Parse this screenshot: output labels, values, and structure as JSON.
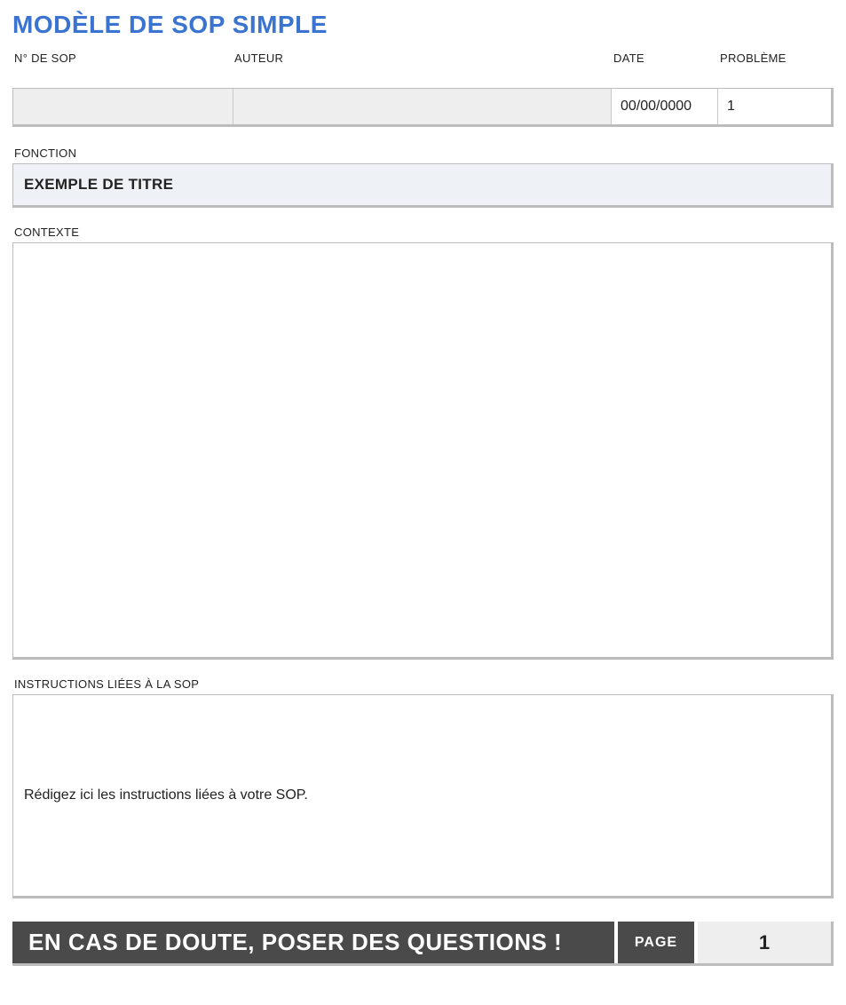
{
  "title": "MODÈLE DE SOP SIMPLE",
  "headers": {
    "sop_no": "N° DE SOP",
    "author": "AUTEUR",
    "date": "DATE",
    "problem": "PROBLÈME"
  },
  "values": {
    "sop_no": "",
    "author": "",
    "date": "00/00/0000",
    "problem": "1"
  },
  "fonction": {
    "label": "FONCTION",
    "value": "EXEMPLE DE TITRE"
  },
  "contexte": {
    "label": "CONTEXTE",
    "value": ""
  },
  "instructions": {
    "label": "INSTRUCTIONS LIÉES À LA SOP",
    "value": "Rédigez ici les instructions liées à votre SOP."
  },
  "footer": {
    "message": "EN CAS DE DOUTE, POSER DES QUESTIONS !",
    "page_label": "PAGE",
    "page_number": "1"
  }
}
